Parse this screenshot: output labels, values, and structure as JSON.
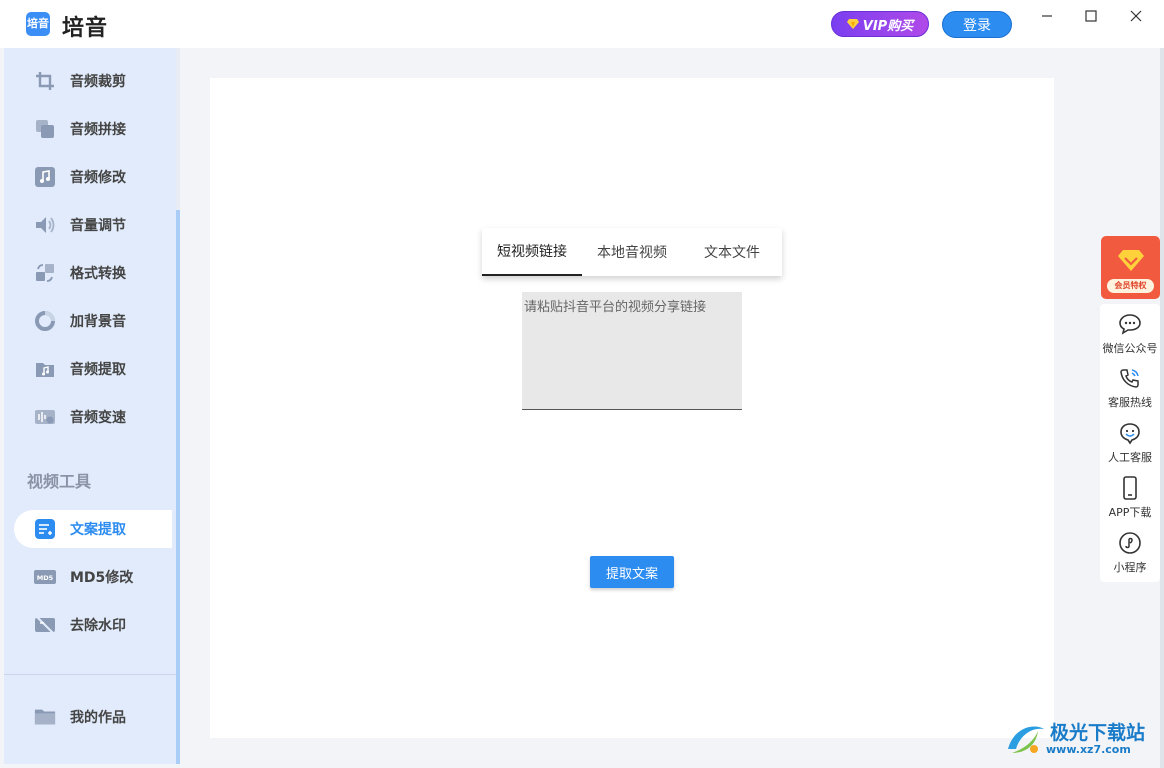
{
  "app": {
    "title": "培音",
    "logo_text": "培音"
  },
  "header": {
    "vip_label": "VIP购买",
    "login_label": "登录"
  },
  "sidebar": {
    "items": [
      {
        "label": "音频裁剪",
        "icon": "crop-icon"
      },
      {
        "label": "音频拼接",
        "icon": "copy-icon"
      },
      {
        "label": "音频修改",
        "icon": "music-note-icon"
      },
      {
        "label": "音量调节",
        "icon": "speaker-icon"
      },
      {
        "label": "格式转换",
        "icon": "format-convert-icon"
      },
      {
        "label": "加背景音",
        "icon": "ring-icon"
      },
      {
        "label": "音频提取",
        "icon": "music-folder-icon"
      },
      {
        "label": "音频变速",
        "icon": "waveform-speed-icon"
      }
    ],
    "section_title": "视频工具",
    "video_items": [
      {
        "label": "文案提取",
        "icon": "document-extract-icon",
        "active": true
      },
      {
        "label": "MD5修改",
        "icon": "md5-icon",
        "icon_text": "MD5"
      },
      {
        "label": "去除水印",
        "icon": "watermark-remove-icon"
      }
    ],
    "bottom_item": {
      "label": "我的作品",
      "icon": "folder-icon"
    }
  },
  "main": {
    "tabs": [
      {
        "label": "短视频链接",
        "active": true
      },
      {
        "label": "本地音视频",
        "active": false
      },
      {
        "label": "文本文件",
        "active": false
      }
    ],
    "input_placeholder": "请粘贴抖音平台的视频分享链接",
    "extract_button": "提取文案"
  },
  "right_panel": {
    "vip_badge": "会员特权",
    "items": [
      {
        "label": "微信公众号",
        "icon": "wechat-chat-icon"
      },
      {
        "label": "客服热线",
        "icon": "phone-icon"
      },
      {
        "label": "人工客服",
        "icon": "customer-service-icon"
      },
      {
        "label": "APP下载",
        "icon": "mobile-icon"
      },
      {
        "label": "小程序",
        "icon": "mini-program-icon"
      }
    ]
  },
  "watermark": {
    "text": "极光下载站",
    "url": "www.xz7.com"
  },
  "colors": {
    "accent": "#2d8cf0",
    "sidebar_bg": "#e1ebfb",
    "vip_purple": "#8a40ee",
    "vip_red": "#f25a40"
  }
}
